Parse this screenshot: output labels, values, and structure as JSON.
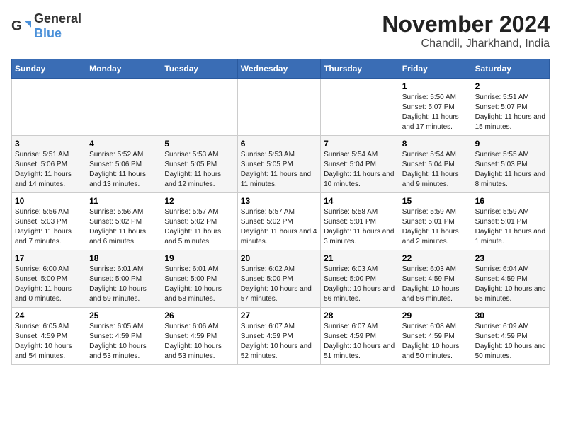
{
  "logo": {
    "text_general": "General",
    "text_blue": "Blue"
  },
  "header": {
    "title": "November 2024",
    "subtitle": "Chandil, Jharkhand, India"
  },
  "days_of_week": [
    "Sunday",
    "Monday",
    "Tuesday",
    "Wednesday",
    "Thursday",
    "Friday",
    "Saturday"
  ],
  "weeks": [
    [
      {
        "day": "",
        "info": ""
      },
      {
        "day": "",
        "info": ""
      },
      {
        "day": "",
        "info": ""
      },
      {
        "day": "",
        "info": ""
      },
      {
        "day": "",
        "info": ""
      },
      {
        "day": "1",
        "info": "Sunrise: 5:50 AM\nSunset: 5:07 PM\nDaylight: 11 hours and 17 minutes."
      },
      {
        "day": "2",
        "info": "Sunrise: 5:51 AM\nSunset: 5:07 PM\nDaylight: 11 hours and 15 minutes."
      }
    ],
    [
      {
        "day": "3",
        "info": "Sunrise: 5:51 AM\nSunset: 5:06 PM\nDaylight: 11 hours and 14 minutes."
      },
      {
        "day": "4",
        "info": "Sunrise: 5:52 AM\nSunset: 5:06 PM\nDaylight: 11 hours and 13 minutes."
      },
      {
        "day": "5",
        "info": "Sunrise: 5:53 AM\nSunset: 5:05 PM\nDaylight: 11 hours and 12 minutes."
      },
      {
        "day": "6",
        "info": "Sunrise: 5:53 AM\nSunset: 5:05 PM\nDaylight: 11 hours and 11 minutes."
      },
      {
        "day": "7",
        "info": "Sunrise: 5:54 AM\nSunset: 5:04 PM\nDaylight: 11 hours and 10 minutes."
      },
      {
        "day": "8",
        "info": "Sunrise: 5:54 AM\nSunset: 5:04 PM\nDaylight: 11 hours and 9 minutes."
      },
      {
        "day": "9",
        "info": "Sunrise: 5:55 AM\nSunset: 5:03 PM\nDaylight: 11 hours and 8 minutes."
      }
    ],
    [
      {
        "day": "10",
        "info": "Sunrise: 5:56 AM\nSunset: 5:03 PM\nDaylight: 11 hours and 7 minutes."
      },
      {
        "day": "11",
        "info": "Sunrise: 5:56 AM\nSunset: 5:02 PM\nDaylight: 11 hours and 6 minutes."
      },
      {
        "day": "12",
        "info": "Sunrise: 5:57 AM\nSunset: 5:02 PM\nDaylight: 11 hours and 5 minutes."
      },
      {
        "day": "13",
        "info": "Sunrise: 5:57 AM\nSunset: 5:02 PM\nDaylight: 11 hours and 4 minutes."
      },
      {
        "day": "14",
        "info": "Sunrise: 5:58 AM\nSunset: 5:01 PM\nDaylight: 11 hours and 3 minutes."
      },
      {
        "day": "15",
        "info": "Sunrise: 5:59 AM\nSunset: 5:01 PM\nDaylight: 11 hours and 2 minutes."
      },
      {
        "day": "16",
        "info": "Sunrise: 5:59 AM\nSunset: 5:01 PM\nDaylight: 11 hours and 1 minute."
      }
    ],
    [
      {
        "day": "17",
        "info": "Sunrise: 6:00 AM\nSunset: 5:00 PM\nDaylight: 11 hours and 0 minutes."
      },
      {
        "day": "18",
        "info": "Sunrise: 6:01 AM\nSunset: 5:00 PM\nDaylight: 10 hours and 59 minutes."
      },
      {
        "day": "19",
        "info": "Sunrise: 6:01 AM\nSunset: 5:00 PM\nDaylight: 10 hours and 58 minutes."
      },
      {
        "day": "20",
        "info": "Sunrise: 6:02 AM\nSunset: 5:00 PM\nDaylight: 10 hours and 57 minutes."
      },
      {
        "day": "21",
        "info": "Sunrise: 6:03 AM\nSunset: 5:00 PM\nDaylight: 10 hours and 56 minutes."
      },
      {
        "day": "22",
        "info": "Sunrise: 6:03 AM\nSunset: 4:59 PM\nDaylight: 10 hours and 56 minutes."
      },
      {
        "day": "23",
        "info": "Sunrise: 6:04 AM\nSunset: 4:59 PM\nDaylight: 10 hours and 55 minutes."
      }
    ],
    [
      {
        "day": "24",
        "info": "Sunrise: 6:05 AM\nSunset: 4:59 PM\nDaylight: 10 hours and 54 minutes."
      },
      {
        "day": "25",
        "info": "Sunrise: 6:05 AM\nSunset: 4:59 PM\nDaylight: 10 hours and 53 minutes."
      },
      {
        "day": "26",
        "info": "Sunrise: 6:06 AM\nSunset: 4:59 PM\nDaylight: 10 hours and 53 minutes."
      },
      {
        "day": "27",
        "info": "Sunrise: 6:07 AM\nSunset: 4:59 PM\nDaylight: 10 hours and 52 minutes."
      },
      {
        "day": "28",
        "info": "Sunrise: 6:07 AM\nSunset: 4:59 PM\nDaylight: 10 hours and 51 minutes."
      },
      {
        "day": "29",
        "info": "Sunrise: 6:08 AM\nSunset: 4:59 PM\nDaylight: 10 hours and 50 minutes."
      },
      {
        "day": "30",
        "info": "Sunrise: 6:09 AM\nSunset: 4:59 PM\nDaylight: 10 hours and 50 minutes."
      }
    ]
  ]
}
